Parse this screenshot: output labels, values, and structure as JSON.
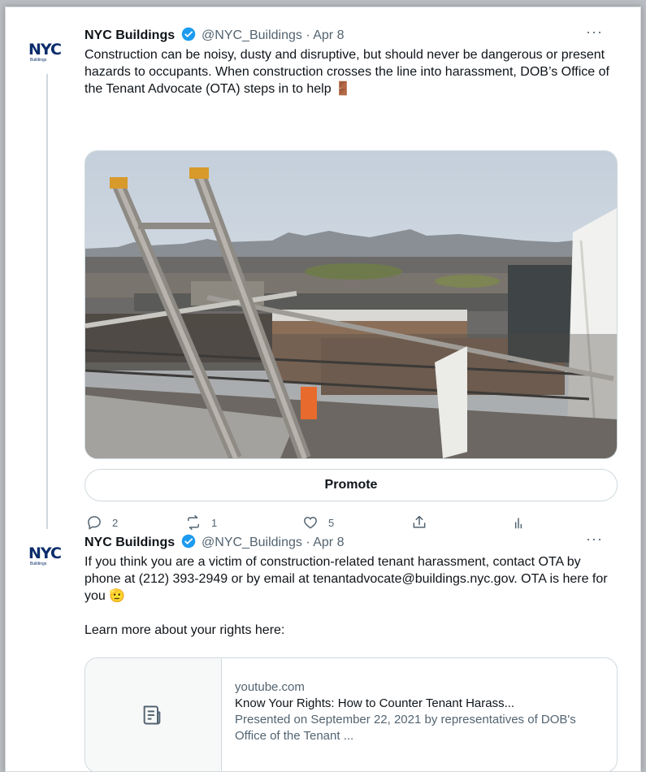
{
  "tweets": [
    {
      "author": "NYC Buildings",
      "handle": "@NYC_Buildings",
      "separator": "·",
      "date": "Apr 8",
      "more": "···",
      "logo": "NYC",
      "logo_sub": "Buildings",
      "text": "Construction can be noisy, dusty and disruptive, but should never be dangerous or present hazards to occupants. When construction crosses the line into harassment, DOB’s Office of the Tenant Advocate (OTA) steps in to help 🚪",
      "promote_label": "Promote",
      "metrics": {
        "replies": "2",
        "retweets": "1",
        "likes": "5"
      }
    },
    {
      "author": "NYC Buildings",
      "handle": "@NYC_Buildings",
      "separator": "·",
      "date": "Apr 8",
      "more": "···",
      "logo": "NYC",
      "logo_sub": "Buildings",
      "text": "If you think you are a victim of construction-related tenant harassment, contact OTA by phone at (212) 393-2949 or by email at tenantadvocate@buildings.nyc.gov. OTA is here for you 🫡\n\nLearn more about your rights here:",
      "card": {
        "domain": "youtube.com",
        "title": "Know Your Rights: How to Counter Tenant Harass...",
        "description": "Presented on September 22, 2021 by representatives of DOB's Office of the Tenant ..."
      }
    }
  ],
  "colors": {
    "verified": "#1d9bf0",
    "logo": "#0b2d6b",
    "muted": "#536471",
    "border": "#cfd9de"
  },
  "icons": [
    "reply-icon",
    "retweet-icon",
    "like-icon",
    "share-icon",
    "analytics-icon",
    "document-icon",
    "verified-badge-icon"
  ]
}
